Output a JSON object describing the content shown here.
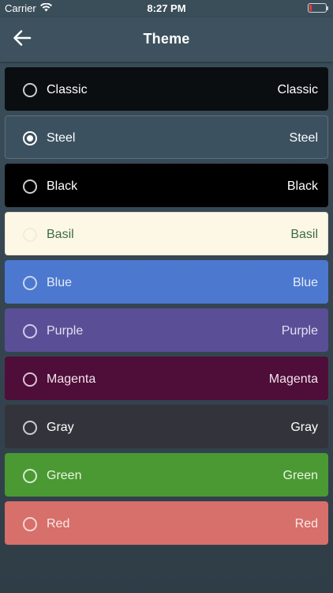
{
  "status_bar": {
    "carrier": "Carrier",
    "time": "8:27 PM"
  },
  "header": {
    "title": "Theme",
    "back_icon": "arrow-left-icon"
  },
  "themes": [
    {
      "label": "Classic",
      "preview": "Classic",
      "bg": "#0b0e10",
      "text": "#ffffff",
      "border": "#0b0e10",
      "radio": "#c9ced2",
      "selected": false
    },
    {
      "label": "Steel",
      "preview": "Steel",
      "bg": "#3c5160",
      "text": "#ffffff",
      "border": "#5b707d",
      "radio": "#ffffff",
      "selected": true
    },
    {
      "label": "Black",
      "preview": "Black",
      "bg": "#000000",
      "text": "#ffffff",
      "border": "#000000",
      "radio": "#c9ced2",
      "selected": false
    },
    {
      "label": "Basil",
      "preview": "Basil",
      "bg": "#fdf8e6",
      "text": "#3c6a4a",
      "border": "#e9e3cf",
      "radio": "#f2ecd8",
      "selected": false
    },
    {
      "label": "Blue",
      "preview": "Blue",
      "bg": "#4c78cf",
      "text": "#e6ecf8",
      "border": "#4c78cf",
      "radio": "#c9d6ef",
      "selected": false
    },
    {
      "label": "Purple",
      "preview": "Purple",
      "bg": "#5a4f97",
      "text": "#e2dff0",
      "border": "#5a4f97",
      "radio": "#cfcbe6",
      "selected": false
    },
    {
      "label": "Magenta",
      "preview": "Magenta",
      "bg": "#4f0d39",
      "text": "#f1e3ec",
      "border": "#4f0d39",
      "radio": "#d9c3d1",
      "selected": false
    },
    {
      "label": "Gray",
      "preview": "Gray",
      "bg": "#33343b",
      "text": "#ffffff",
      "border": "#33343b",
      "radio": "#c9ced2",
      "selected": false
    },
    {
      "label": "Green",
      "preview": "Green",
      "bg": "#4a9932",
      "text": "#eaf5e3",
      "border": "#4a9932",
      "radio": "#d6ecd0",
      "selected": false
    },
    {
      "label": "Red",
      "preview": "Red",
      "bg": "#d76f6a",
      "text": "#fbe9e8",
      "border": "#d76f6a",
      "radio": "#f6d6d4",
      "selected": false
    }
  ]
}
